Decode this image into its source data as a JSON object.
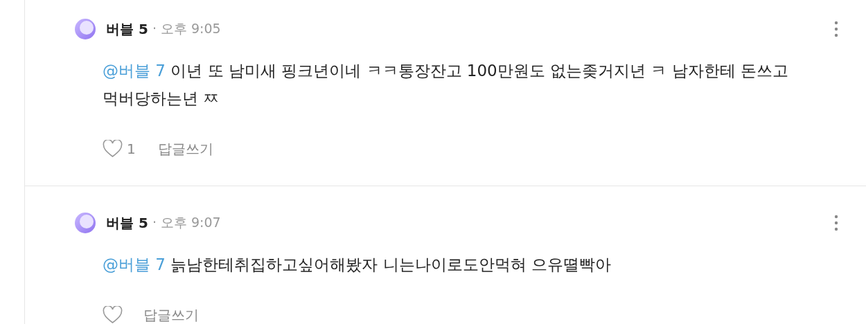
{
  "comments": [
    {
      "author": "버블 5",
      "time": "· 오후 9:05",
      "mention": "@버블 7",
      "text": "이년 또 남미새 핑크년이네 ㅋㅋ통장잔고 100만원도 없는좆거지년 ㅋ 남자한테 돈쓰고 먹버당하는년 ㅉ",
      "liked": false,
      "likes": "1",
      "reply": "답글쓰기"
    },
    {
      "author": "버블 5",
      "time": "· 오후 9:07",
      "mention": "@버블 7",
      "text": "늙남한테취집하고싶어해봤자 니는나이로도안먹혀 으유뗠빡아",
      "liked": false,
      "reply": "답글쓰기"
    }
  ]
}
